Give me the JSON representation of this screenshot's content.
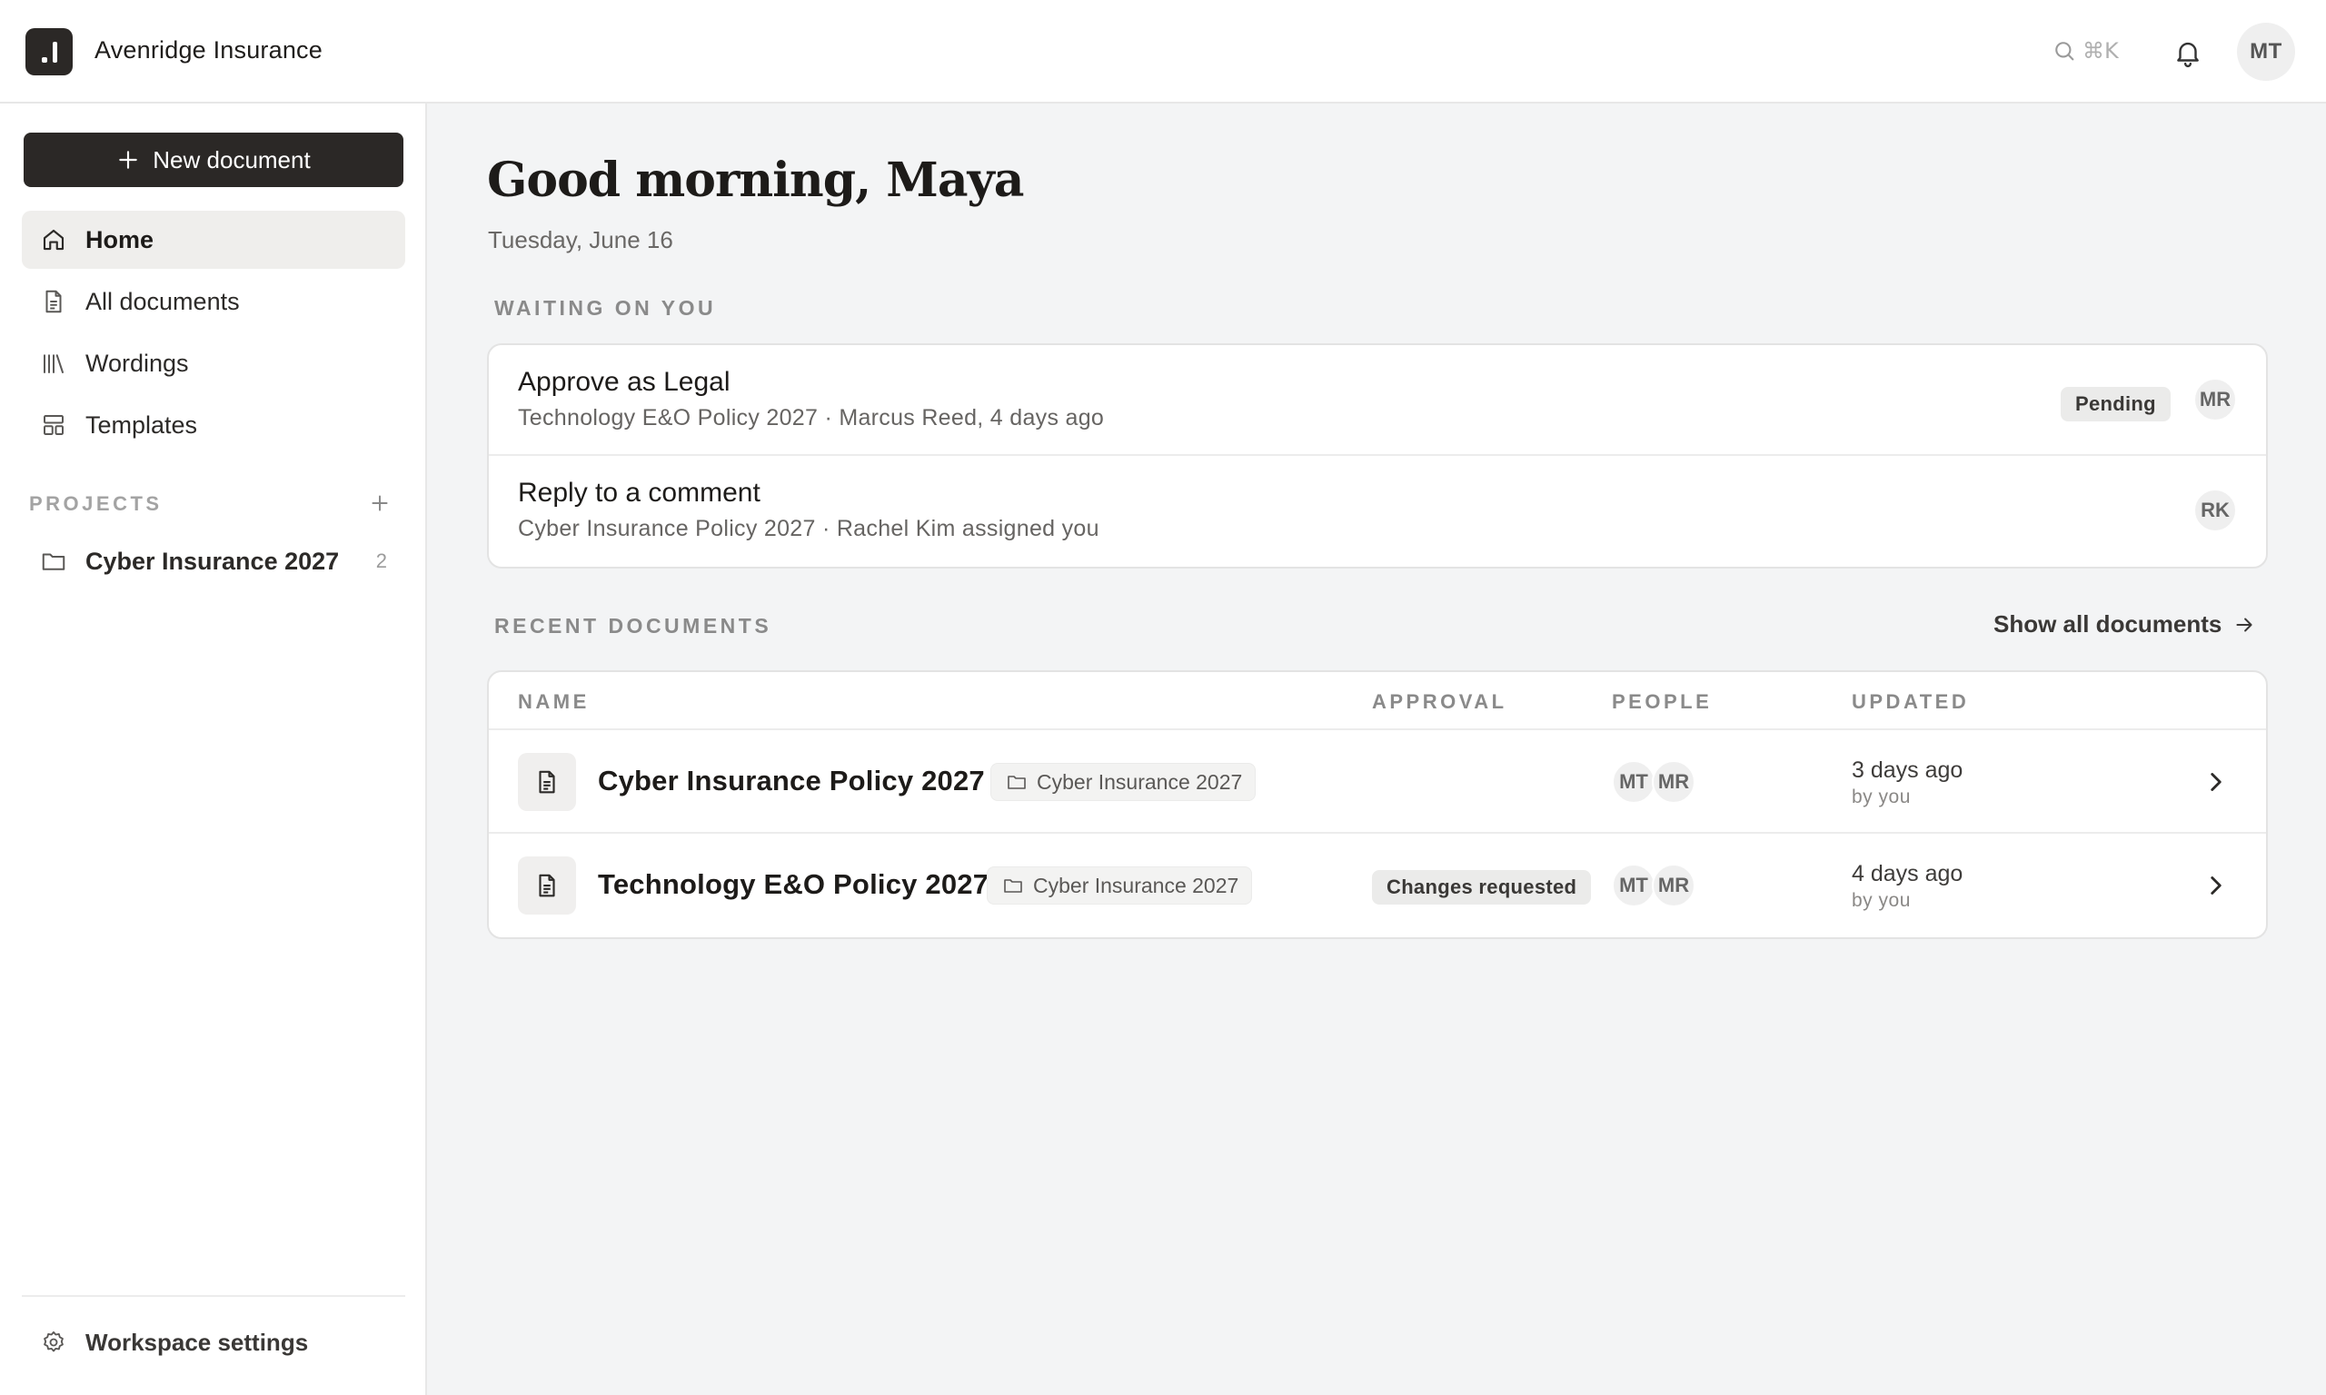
{
  "topbar": {
    "org_name": "Avenridge Insurance",
    "search_shortcut": "⌘K",
    "user_initials": "MT"
  },
  "sidebar": {
    "new_document_label": "New document",
    "nav": [
      {
        "label": "Home",
        "icon": "home-icon",
        "active": true
      },
      {
        "label": "All documents",
        "icon": "document-icon",
        "active": false
      },
      {
        "label": "Wordings",
        "icon": "library-icon",
        "active": false
      },
      {
        "label": "Templates",
        "icon": "template-icon",
        "active": false
      }
    ],
    "projects_label": "PROJECTS",
    "projects": [
      {
        "label": "Cyber Insurance 2027",
        "count": "2",
        "icon": "folder-icon"
      }
    ],
    "settings_label": "Workspace settings"
  },
  "main": {
    "greeting": "Good morning, Maya",
    "date": "Tuesday, June 16",
    "waiting_label": "WAITING ON YOU",
    "tasks": [
      {
        "title": "Approve as Legal",
        "subtitle": "Technology E&O Policy 2027 · Marcus Reed, 4 days ago",
        "status": "Pending",
        "avatar": "MR"
      },
      {
        "title": "Reply to a comment",
        "subtitle": "Cyber Insurance Policy 2027 · Rachel Kim assigned you",
        "status": "",
        "avatar": "RK"
      }
    ],
    "recent_label": "RECENT DOCUMENTS",
    "show_all_label": "Show all documents",
    "table": {
      "columns": [
        "NAME",
        "APPROVAL",
        "PEOPLE",
        "UPDATED"
      ],
      "rows": [
        {
          "name": "Cyber Insurance Policy 2027",
          "project": "Cyber Insurance 2027",
          "approval": "",
          "people": [
            "MT",
            "MR"
          ],
          "updated": "3 days ago",
          "by": "by you"
        },
        {
          "name": "Technology E&O Policy 2027",
          "project": "Cyber Insurance 2027",
          "approval": "Changes requested",
          "people": [
            "MT",
            "MR"
          ],
          "updated": "4 days ago",
          "by": "by you"
        }
      ]
    }
  },
  "colors": {
    "brand_dark": "#2b2826",
    "background": "#f3f4f5",
    "surface": "#ffffff",
    "muted_text": "#8a8a8a"
  }
}
